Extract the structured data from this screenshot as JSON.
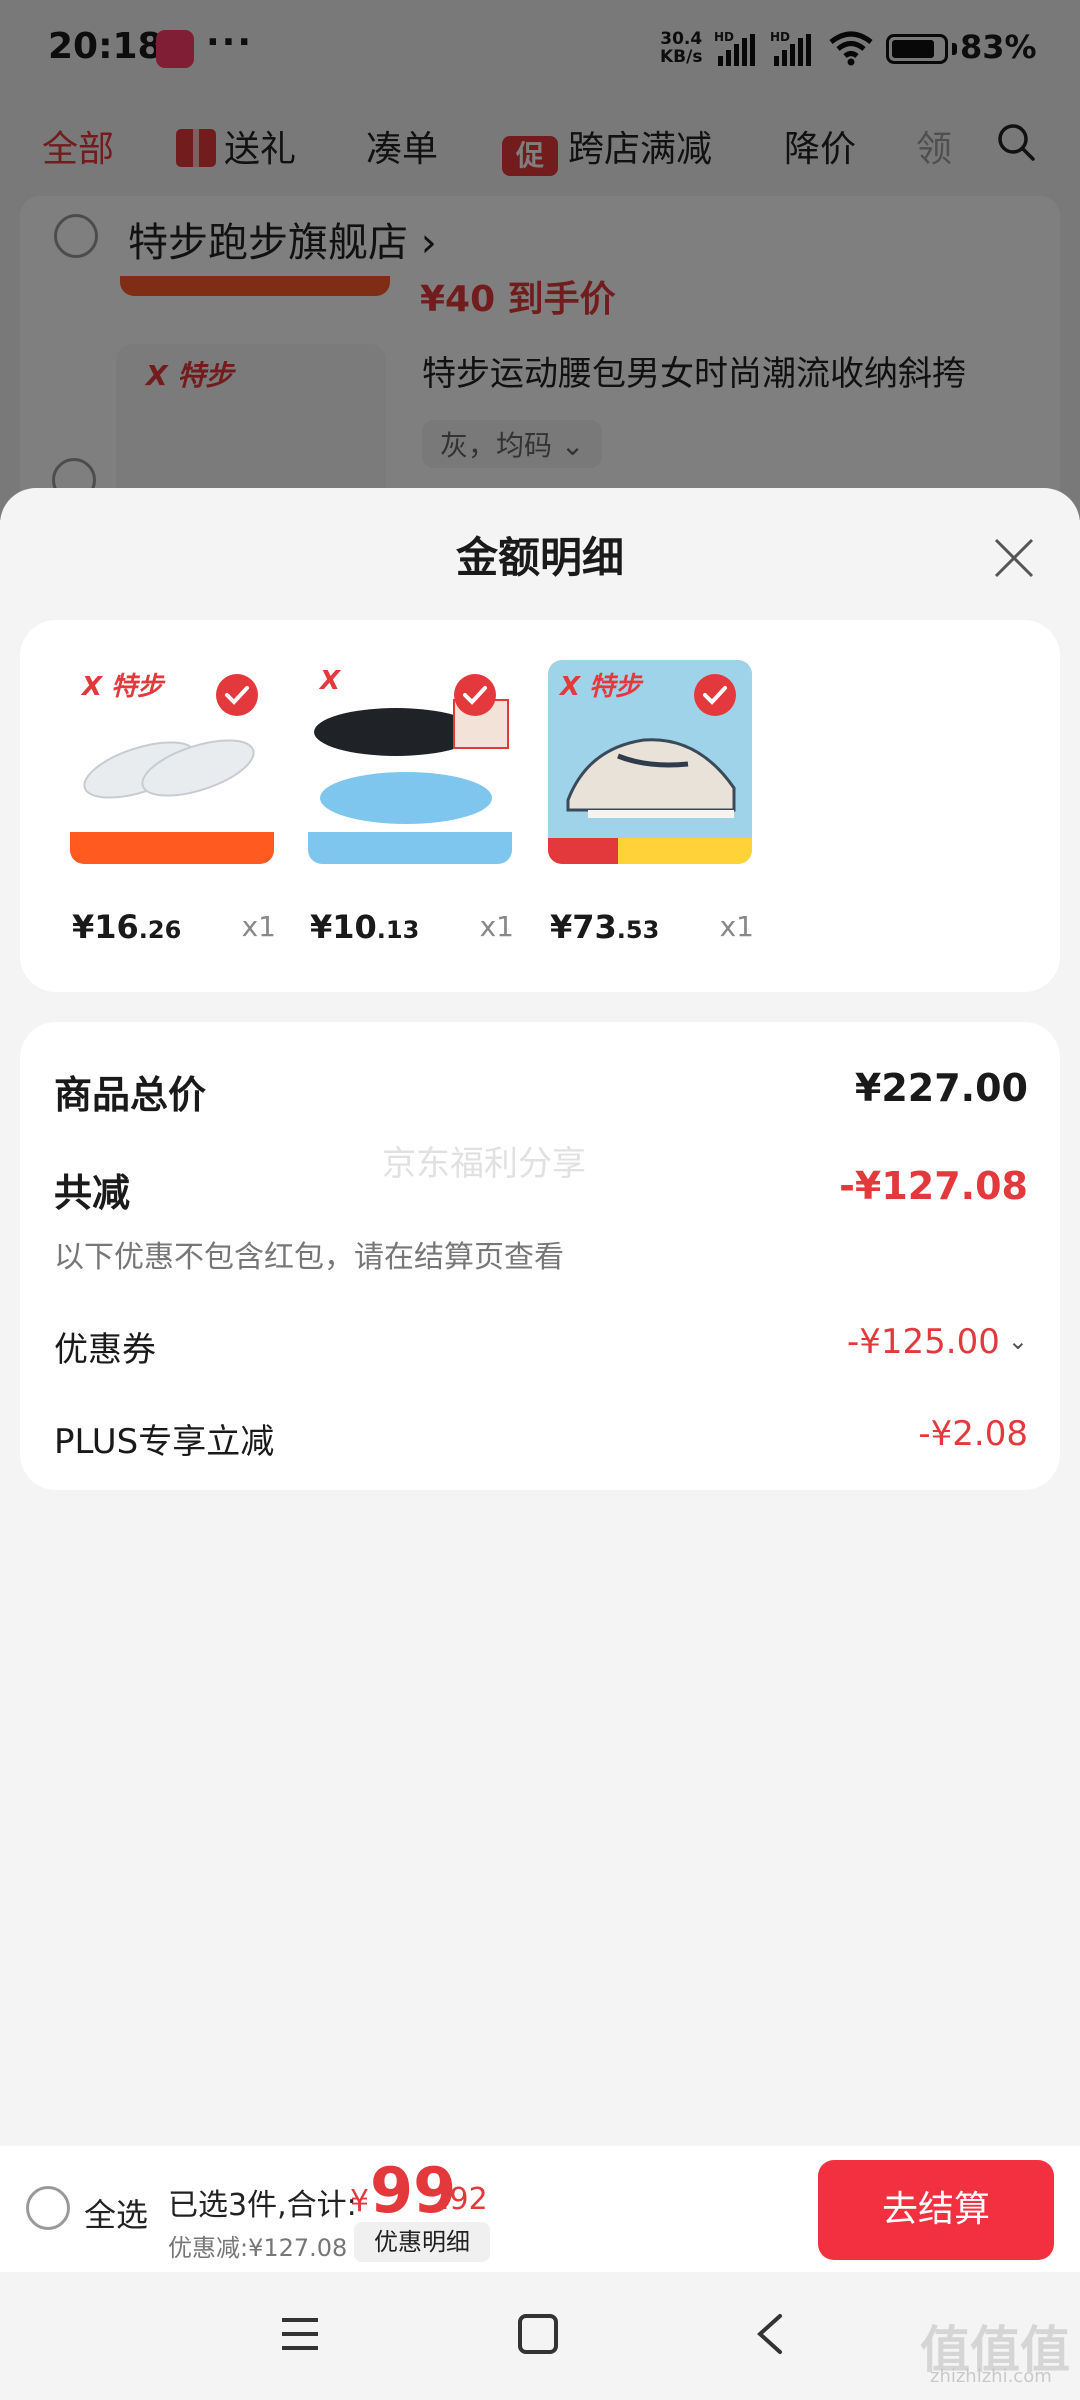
{
  "status_bar": {
    "time": "20:18",
    "more": "···",
    "net_speed_value": "30.4",
    "net_speed_unit": "KB/s",
    "hd": "HD",
    "battery_percent": "83%",
    "battery_level": 0.83
  },
  "tabs": [
    {
      "label": "全部"
    },
    {
      "label": "送礼"
    },
    {
      "label": "凑单"
    },
    {
      "label": "跨店满减",
      "badge": "促"
    },
    {
      "label": "降价"
    },
    {
      "label": "领"
    }
  ],
  "store": {
    "name": "特步跑步旗舰店",
    "chevron": "›",
    "partial_price": "¥40 到手价"
  },
  "cart_item": {
    "logo": "X 特步",
    "title": "特步运动腰包男女时尚潮流收纳斜挎",
    "variant": "灰，均码 ⌄"
  },
  "sheet": {
    "title": "金额明细",
    "products": [
      {
        "logo": "X 特步",
        "price_int": "¥16",
        "price_dec": ".26",
        "qty": "x1",
        "colors": [
          "#ffffff",
          "#e9ecef",
          "#ff5a1f"
        ]
      },
      {
        "logo": "X",
        "price_int": "¥10",
        "price_dec": ".13",
        "qty": "x1",
        "colors": [
          "#ffffff",
          "#1f2328",
          "#7fc6ef"
        ]
      },
      {
        "logo": "X 特步",
        "price_int": "¥73",
        "price_dec": ".53",
        "qty": "x1",
        "colors": [
          "#9fd3ea",
          "#e9e2d8",
          "#ffd23a"
        ]
      }
    ],
    "summary": {
      "total_label": "商品总价",
      "total_value": "¥227.00",
      "reduce_label": "共减",
      "reduce_value": "-¥127.08",
      "note": "以下优惠不包含红包，请在结算页查看",
      "coupon_label": "优惠券",
      "coupon_value": "-¥125.00",
      "plus_label": "PLUS专享立减",
      "plus_value": "-¥2.08",
      "watermark": "京东福利分享"
    }
  },
  "checkout": {
    "select_all": "全选",
    "selected": "已选3件,合计:",
    "currency": "¥",
    "total_int": "99",
    "total_dec": ".92",
    "discount": "优惠减:¥127.08",
    "detail_chip": "优惠明细",
    "button": "去结算"
  },
  "corner_watermark": {
    "mark": "值值值",
    "site": "zhizhizhi.com"
  },
  "colors": {
    "accent": "#e4393c",
    "button": "#f3303f",
    "overlay": "rgba(0,0,0,0.5)"
  }
}
